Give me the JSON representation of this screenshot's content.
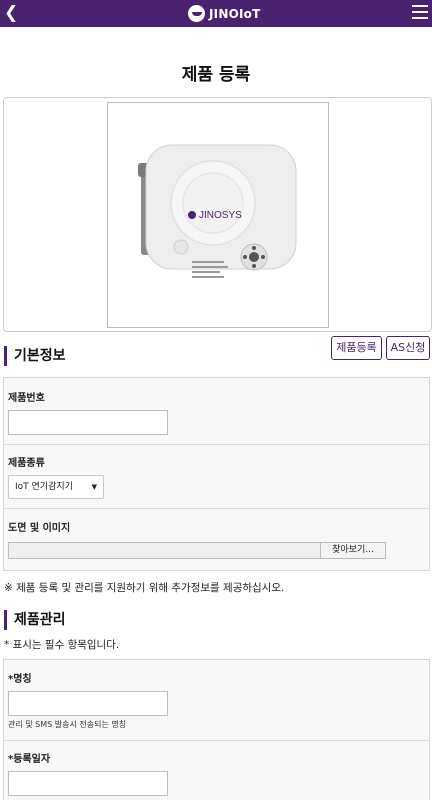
{
  "header": {
    "logo_text": "JINOIoT",
    "back_icon": "chevron-left-icon",
    "menu_icon": "hamburger-menu-icon",
    "background": "#4a2370"
  },
  "page": {
    "title": "제품 등록"
  },
  "product_image": {
    "brand_text": "JINOSYS"
  },
  "basic_info": {
    "heading": "기본정보",
    "register_button": "제품등록",
    "as_button": "AS신청",
    "serial_label": "제품번호",
    "serial_value": "",
    "type_label": "제품종류",
    "type_selected": "IoT 연기감지기",
    "drawing_label": "도면 및 이미지",
    "browse_button": "찾아보기..."
  },
  "notice": "※ 제품 등록 및 관리를 지원하기 위해 추가정보를 제공하십시오.",
  "management": {
    "heading": "제품관리",
    "required_note": "* 표시는 필수 항목입니다.",
    "name_label": "*명칭",
    "name_value": "",
    "name_help": "관리 및 SMS 발송시 전송되는 명칭",
    "date_label": "*등록일자",
    "date_value": ""
  }
}
